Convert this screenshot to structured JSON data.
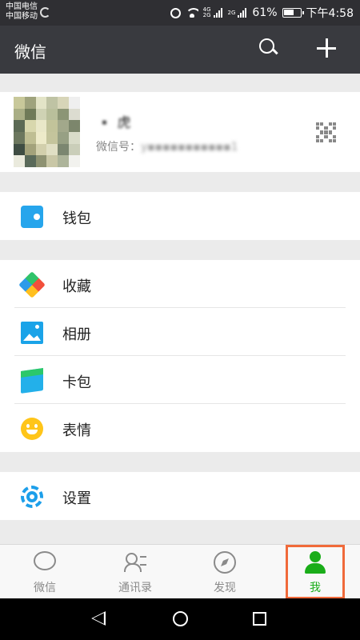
{
  "status_bar": {
    "carrier_1": "中国电信",
    "carrier_2": "中国移动",
    "net_1": "4G",
    "net_2": "2G",
    "net_3": "2G",
    "battery": "61%",
    "time": "下午4:58"
  },
  "header": {
    "title": "微信"
  },
  "profile": {
    "nickname": "▪️ 虎",
    "wechat_id_label": "微信号：",
    "wechat_id_value": "y▪▪▪▪▪▪▪▪▪▪▪1"
  },
  "menu": {
    "wallet": "钱包",
    "favorites": "收藏",
    "album": "相册",
    "cards": "卡包",
    "stickers": "表情",
    "settings": "设置"
  },
  "tabs": [
    {
      "label": "微信",
      "icon": "chat-bubble-icon"
    },
    {
      "label": "通讯录",
      "icon": "contacts-icon"
    },
    {
      "label": "发现",
      "icon": "compass-icon"
    },
    {
      "label": "我",
      "icon": "person-icon",
      "active": true
    }
  ],
  "colors": {
    "active_tab": "#1aad19",
    "highlight_box": "#f06a3a",
    "header_bg": "#393a3f"
  }
}
